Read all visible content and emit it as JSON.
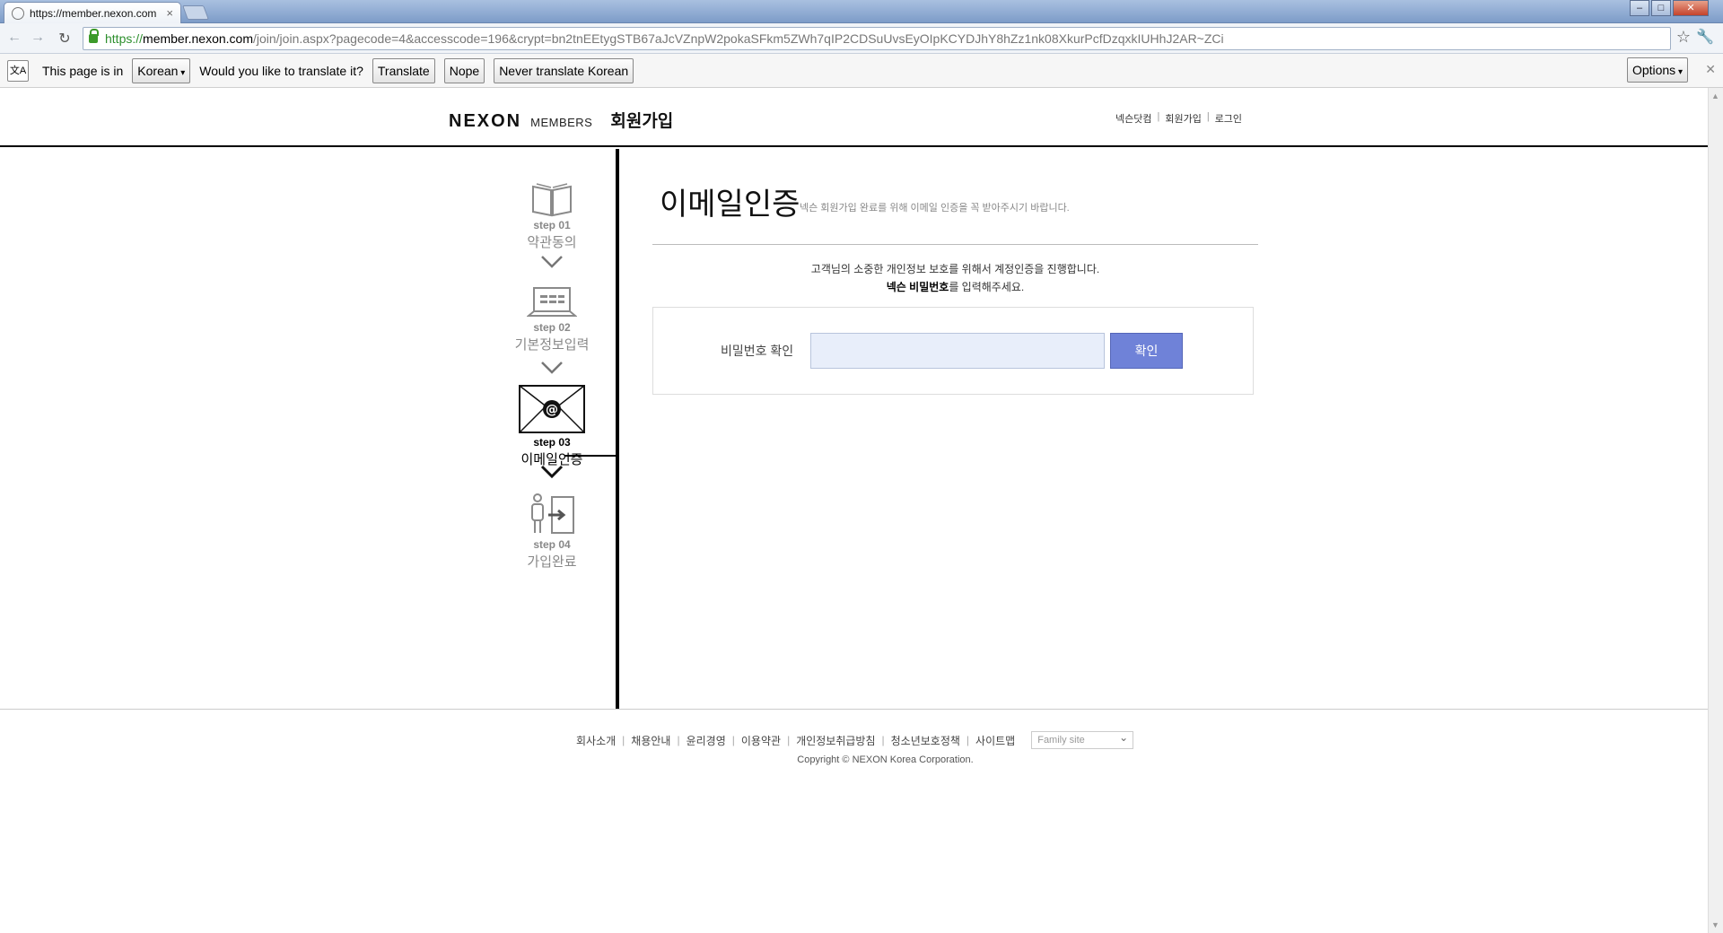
{
  "browser": {
    "tab_title": "https://member.nexon.com",
    "tab_close": "×",
    "url_scheme": "https://",
    "url_host": "member.nexon.com",
    "url_path": "/join/join.aspx?pagecode=4&accesscode=196&crypt=bn2tnEEtygSTB67aJcVZnpW2pokaSFkm5ZWh7qIP2CDSuUvsEyOIpKCYDJhY8hZz1nk08XkurPcfDzqxkIUHhJ2AR~ZCi",
    "window_controls": {
      "minimize": "–",
      "maximize": "□",
      "close": "✕"
    }
  },
  "infobar": {
    "icon_text": "文A",
    "prefix": "This page is in",
    "language": "Korean",
    "question": "Would you like to translate it?",
    "translate_label": "Translate",
    "nope_label": "Nope",
    "never_label": "Never translate Korean",
    "options_label": "Options",
    "close_glyph": "✕"
  },
  "header": {
    "logo_nexon": "NEXON",
    "logo_members": "MEMBERS",
    "logo_title": "회원가입",
    "links": [
      "넥슨닷컴",
      "회원가입",
      "로그인"
    ]
  },
  "steps": [
    {
      "num": "step 01",
      "label": "약관동의",
      "icon": "book-icon",
      "active": false
    },
    {
      "num": "step 02",
      "label": "기본정보입력",
      "icon": "laptop-icon",
      "active": false
    },
    {
      "num": "step 03",
      "label": "이메일인증",
      "icon": "email-envelope-icon",
      "active": true
    },
    {
      "num": "step 04",
      "label": "가입완료",
      "icon": "person-door-icon",
      "active": false
    }
  ],
  "main": {
    "title": "이메일인증",
    "subtitle": "넥슨 회원가입 완료를 위해 이메일 인증을 꼭 받아주시기 바랍니다.",
    "notice_line1": "고객님의 소중한 개인정보 보호를 위해서 계정인증을 진행합니다.",
    "notice_bold": "넥슨 비밀번호",
    "notice_line2_rest": "를 입력해주세요.",
    "password_label": "비밀번호 확인",
    "password_value": "",
    "confirm_label": "확인"
  },
  "footer": {
    "links": [
      "회사소개",
      "채용안내",
      "윤리경영",
      "이용약관",
      "개인정보취급방침",
      "청소년보호정책",
      "사이트맵"
    ],
    "family_site": "Family site",
    "copyright": "Copyright © NEXON Korea Corporation."
  }
}
